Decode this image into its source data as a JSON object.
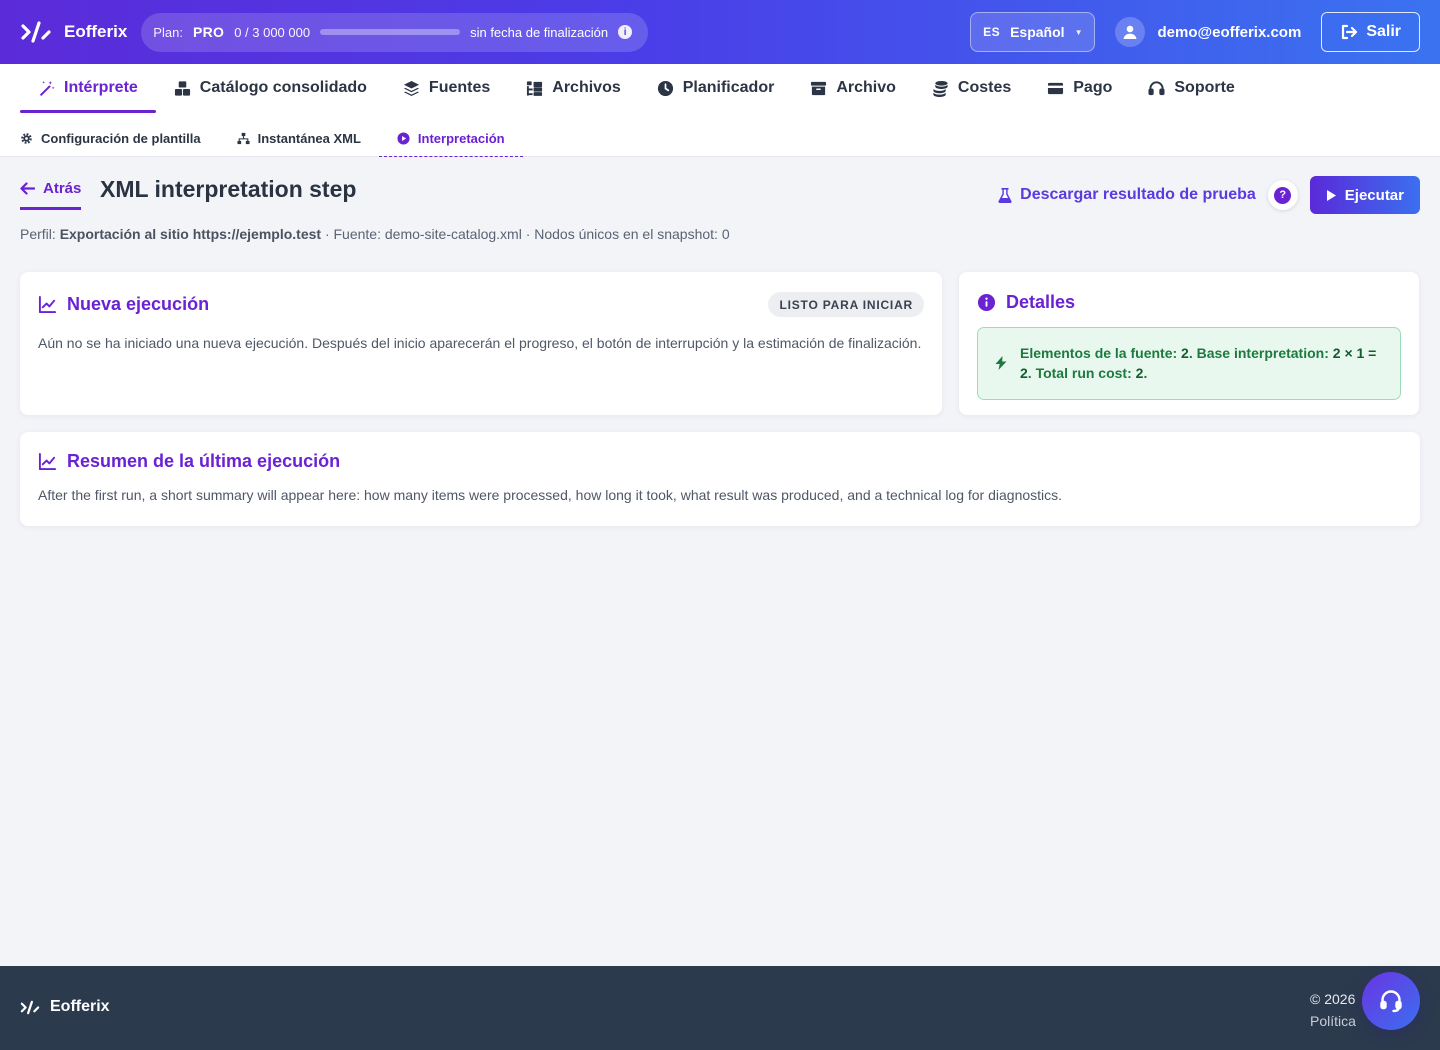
{
  "brand": {
    "name": "Eofferix"
  },
  "plan": {
    "label": "Plan:",
    "tier": "PRO",
    "usage": "0 / 3 000 000",
    "progress_fraction": 0,
    "expiry": "sin fecha de finalización"
  },
  "language": {
    "code": "ES",
    "name": "Español"
  },
  "user": {
    "email": "demo@eofferix.com"
  },
  "logout_label": "Salir",
  "nav": {
    "tabs": [
      {
        "label": "Intérprete",
        "icon": "magic-wand-icon",
        "active": true
      },
      {
        "label": "Catálogo consolidado",
        "icon": "boxes-icon"
      },
      {
        "label": "Fuentes",
        "icon": "layers-icon"
      },
      {
        "label": "Archivos",
        "icon": "folder-tree-icon"
      },
      {
        "label": "Planificador",
        "icon": "clock-icon"
      },
      {
        "label": "Archivo",
        "icon": "archive-icon"
      },
      {
        "label": "Costes",
        "icon": "coins-icon"
      },
      {
        "label": "Pago",
        "icon": "credit-card-icon"
      },
      {
        "label": "Soporte",
        "icon": "headset-icon"
      }
    ],
    "subtabs": [
      {
        "label": "Configuración de plantilla",
        "icon": "gear-icon"
      },
      {
        "label": "Instantánea XML",
        "icon": "sitemap-icon"
      },
      {
        "label": "Interpretación",
        "icon": "play-circle-icon",
        "active": true
      }
    ]
  },
  "page": {
    "back_label": "Atrás",
    "title": "XML interpretation step",
    "meta": {
      "profile_label": "Perfil:",
      "profile_value": "Exportación al sitio https://ejemplo.test",
      "source_text": "· Fuente: demo-site-catalog.xml · Nodos únicos en el snapshot: 0"
    },
    "download_label": "Descargar resultado de prueba",
    "help_label": "?",
    "run_label": "Ejecutar"
  },
  "new_run": {
    "title": "Nueva ejecución",
    "status": "LISTO PARA INICIAR",
    "description": "Aún no se ha iniciado una nueva ejecución. Después del inicio aparecerán el progreso, el botón de interrupción y la estimación de finalización."
  },
  "details": {
    "title": "Detalles",
    "line": {
      "p1": "Elementos de la fuente: ",
      "v1": "2",
      "p2": ". Base interpretation: ",
      "v2": "2 × 1 = 2",
      "p3": ". Total run cost: ",
      "v3": "2",
      "p4": "."
    }
  },
  "last_run": {
    "title": "Resumen de la última ejecución",
    "description": "After the first run, a short summary will appear here: how many items were processed, how long it took, what result was produced, and a technical log for diagnostics."
  },
  "footer": {
    "brand": "Eofferix",
    "copyright": "© 2026",
    "policy": "Política"
  },
  "colors": {
    "accent": "#6a22d3",
    "success": "#1d7a3f",
    "header_from": "#5b2bd9",
    "header_to": "#3a73f0"
  }
}
